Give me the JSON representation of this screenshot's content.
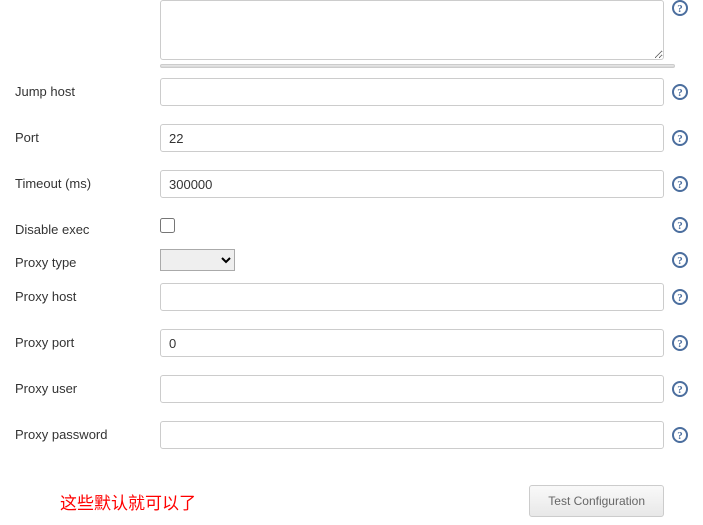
{
  "fields": {
    "textarea_value": "",
    "jump_host": {
      "label": "Jump host",
      "value": ""
    },
    "port": {
      "label": "Port",
      "value": "22"
    },
    "timeout": {
      "label": "Timeout (ms)",
      "value": "300000"
    },
    "disable_exec": {
      "label": "Disable exec"
    },
    "proxy_type": {
      "label": "Proxy type",
      "selected": ""
    },
    "proxy_host": {
      "label": "Proxy host",
      "value": ""
    },
    "proxy_port": {
      "label": "Proxy port",
      "value": "0"
    },
    "proxy_user": {
      "label": "Proxy user",
      "value": ""
    },
    "proxy_password": {
      "label": "Proxy password",
      "value": ""
    }
  },
  "note": "这些默认就可以了",
  "buttons": {
    "test_configuration": "Test Configuration"
  }
}
